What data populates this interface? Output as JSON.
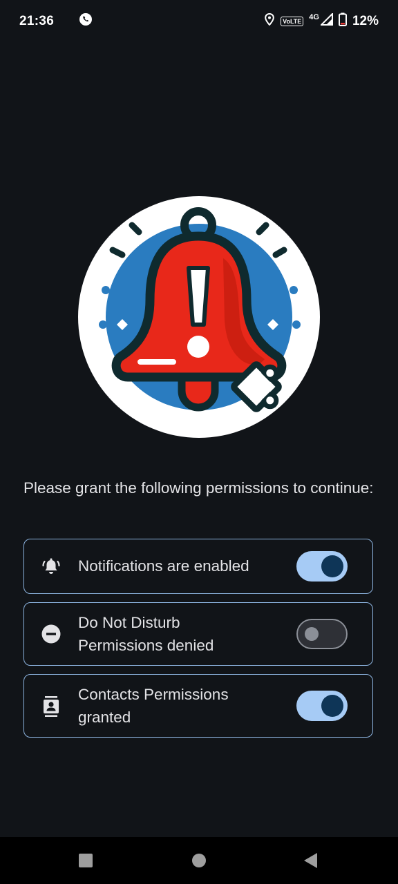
{
  "status_bar": {
    "time": "21:36",
    "volte": "VoLTE",
    "network": "4G",
    "battery": "12%"
  },
  "hero": {
    "icon": "alert-bell-puzzle-icon",
    "colors": {
      "circle": "#ffffff",
      "ring": "#2a7cc0",
      "bell": "#e8281a",
      "outline": "#0f2a2e"
    }
  },
  "prompt": "Please grant the following permissions to continue:",
  "permissions": [
    {
      "icon": "notification-alert-icon",
      "line1": "Notifications are enabled",
      "line2": "",
      "enabled": true
    },
    {
      "icon": "do-not-disturb-icon",
      "line1": "Do Not Disturb",
      "line2": "Permissions denied",
      "enabled": false
    },
    {
      "icon": "contacts-icon",
      "line1": "Contacts Permissions",
      "line2": "granted",
      "enabled": true
    }
  ],
  "colors": {
    "background": "#111418",
    "card_border": "#8db4e0",
    "toggle_on_track": "#a6cbf5",
    "toggle_on_thumb": "#0e3557",
    "toggle_off": "#8b8f97"
  }
}
